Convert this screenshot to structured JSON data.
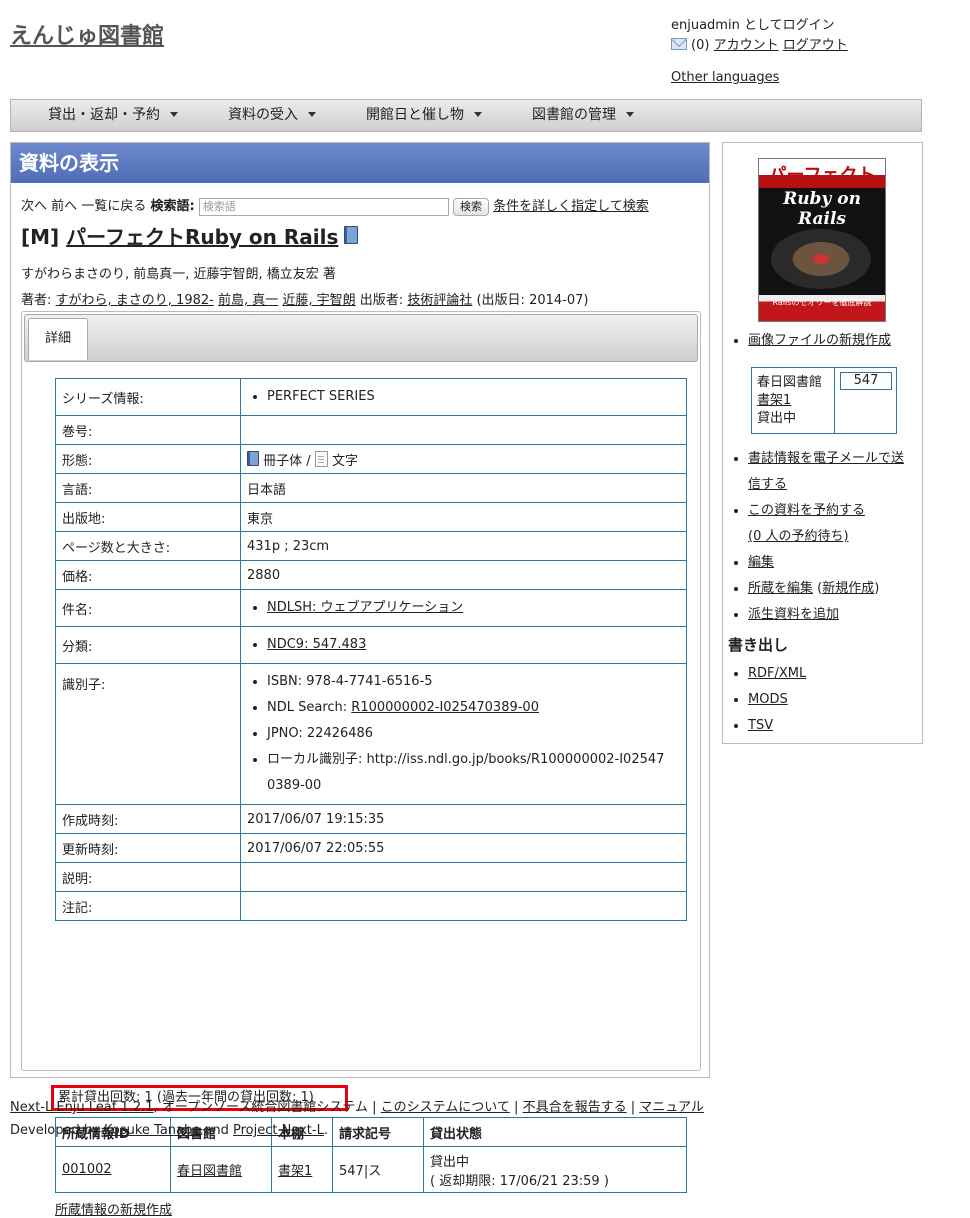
{
  "site": {
    "title": "えんじゅ図書館"
  },
  "login": {
    "text": "enjuadmin としてログイン",
    "mail_count": "(0)",
    "account": "アカウント",
    "logout": "ログアウト"
  },
  "other_languages": "Other languages",
  "menu": [
    "貸出・返却・予約",
    "資料の受入",
    "開館日と催し物",
    "図書館の管理"
  ],
  "page": {
    "header": "資料の表示",
    "nav": {
      "next": "次へ",
      "prev": "前へ",
      "list": "一覧に戻る",
      "search_label": "検索語:",
      "search_placeholder": "検索語",
      "search_button": "検索",
      "advanced": "条件を詳しく指定して検索"
    },
    "item": {
      "prefix": "[M]",
      "title": "パーフェクトRuby on Rails",
      "statement": "すがわらまさのり, 前島真一, 近藤宇智朗, 橋立友宏 著",
      "creators_label": "著者:",
      "creators": [
        "すがわら, まさのり, 1982-",
        "前島, 真一",
        "近藤, 宇智朗"
      ],
      "publisher_label": "出版者:",
      "publisher": "技術評論社",
      "pub_date": "(出版日: 2014-07)"
    },
    "tab": "詳細",
    "details": {
      "series_k": "シリーズ情報:",
      "series_v": "PERFECT SERIES",
      "volume_k": "巻号:",
      "form_k": "形態:",
      "form_v1": "冊子体",
      "form_sep": "/",
      "form_v2": "文字",
      "lang_k": "言語:",
      "lang_v": "日本語",
      "place_k": "出版地:",
      "place_v": "東京",
      "pages_k": "ページ数と大きさ:",
      "pages_v": "431p ; 23cm",
      "price_k": "価格:",
      "price_v": "2880",
      "subject_k": "件名:",
      "subject_v": "NDLSH: ウェブアプリケーション",
      "class_k": "分類:",
      "class_v": "NDC9: 547.483",
      "ids_k": "識別子:",
      "isbn": "ISBN: 978-4-7741-6516-5",
      "ndl_label": "NDL Search:",
      "ndl_v": "R100000002-I025470389-00",
      "jpno": "JPNO: 22426486",
      "local_a": "ローカル識別子: http://iss.ndl.go.jp/books/R100000002-I02547",
      "local_b": "0389-00",
      "created_k": "作成時刻:",
      "created_v": "2017/06/07 19:15:35",
      "updated_k": "更新時刻:",
      "updated_v": "2017/06/07 22:05:55",
      "desc_k": "説明:",
      "note_k": "注記:"
    },
    "checkout_count": "累計貸出回数: 1 (過去一年間の貸出回数: 1)",
    "items_table": {
      "headers": [
        "所蔵情報ID",
        "図書館",
        "本棚",
        "請求記号",
        "貸出状態"
      ],
      "row": {
        "id": "001002",
        "library": "春日図書館",
        "shelf": "書架1",
        "call_number": "547|ス",
        "status": "貸出中",
        "due": "( 返却期限: 17/06/21 23:59 )"
      }
    },
    "new_item": "所蔵情報の新規作成"
  },
  "side": {
    "cover": {
      "line1": "パーフェクト",
      "line2": "Ruby on Rails",
      "line3": "Railsのセオリーを徹底解説"
    },
    "new_image": "画像ファイルの新規作成",
    "holding": {
      "library": "春日図書館",
      "shelf": "書架1",
      "status": "貸出中",
      "count": "547"
    },
    "links": {
      "email": "書誌情報を電子メールで送信する",
      "reserve": "この資料を予約する",
      "waiting": "(0 人の予約待ち)",
      "edit": "編集",
      "edit_items": "所蔵を編集",
      "new_item": "新規作成",
      "derived": "派生資料を追加"
    },
    "export_title": "書き出し",
    "exports": [
      "RDF/XML",
      "MODS",
      "TSV"
    ]
  },
  "footer": {
    "product": "Next-L Enju Leaf 1.2.1",
    "desc": ", オープンソース統合図書館システム |",
    "about": "このシステムについて",
    "bug": "不具合を報告する",
    "manual": "マニュアル",
    "developed_by": "Developed by",
    "author": "Kosuke Tanabe",
    "and": "and",
    "project": "Project Next-L",
    "period": "."
  }
}
